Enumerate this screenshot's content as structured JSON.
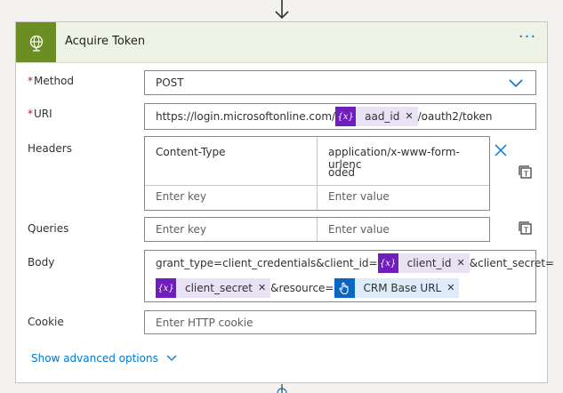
{
  "card": {
    "title": "Acquire Token",
    "more_label": "···"
  },
  "method": {
    "label": "Method",
    "required_mark": "*",
    "value": "POST"
  },
  "uri": {
    "label": "URI",
    "required_mark": "*",
    "prefix": "https://login.microsoftonline.com/",
    "token": "aad_id",
    "suffix": "/oauth2/token"
  },
  "headers": {
    "label": "Headers",
    "row1_key": "Content-Type",
    "row1_value_line1": "application/x-www-form-urlenc",
    "row1_value_line2": "oded",
    "key_placeholder": "Enter key",
    "value_placeholder": "Enter value"
  },
  "queries": {
    "label": "Queries",
    "key_placeholder": "Enter key",
    "value_placeholder": "Enter value"
  },
  "body": {
    "label": "Body",
    "text1": "grant_type=client_credentials&client_id=",
    "token1": "client_id",
    "text2": "&client_secret=",
    "token2": "client_secret",
    "text3": "&resource=",
    "token3": "CRM Base URL"
  },
  "cookie": {
    "label": "Cookie",
    "placeholder": "Enter HTTP cookie"
  },
  "advanced": {
    "label": "Show advanced options"
  },
  "token_icon_text": "{x}",
  "remove_glyph": "✕",
  "colors": {
    "accent": "#0078d4",
    "header_bg": "#eef3e6",
    "connector_icon": "#6b8e23",
    "variable_token": "#6f1dbc",
    "trigger_token": "#0a66c2"
  }
}
